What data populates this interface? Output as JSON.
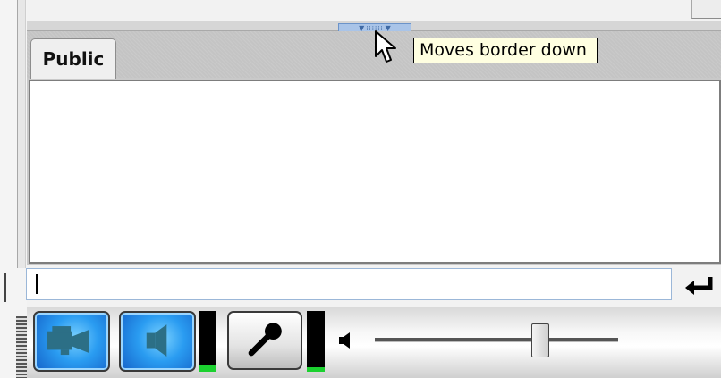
{
  "tabs": [
    {
      "label": "Public",
      "active": true
    }
  ],
  "splitter": {
    "tooltip": "Moves border down"
  },
  "message_input": {
    "value": ""
  },
  "toolbar": {
    "camera": {
      "icon": "video-camera-icon",
      "active": true
    },
    "speaker": {
      "icon": "speaker-icon",
      "active": true
    },
    "speaker_level": 0.1,
    "microphone": {
      "icon": "microphone-icon",
      "active": false
    },
    "microphone_level": 0.08,
    "volume": 0.68
  },
  "colors": {
    "accent_blue": "#2a9cf1",
    "tooltip_bg": "#ffffe1",
    "meter_green": "#1bd12f"
  }
}
